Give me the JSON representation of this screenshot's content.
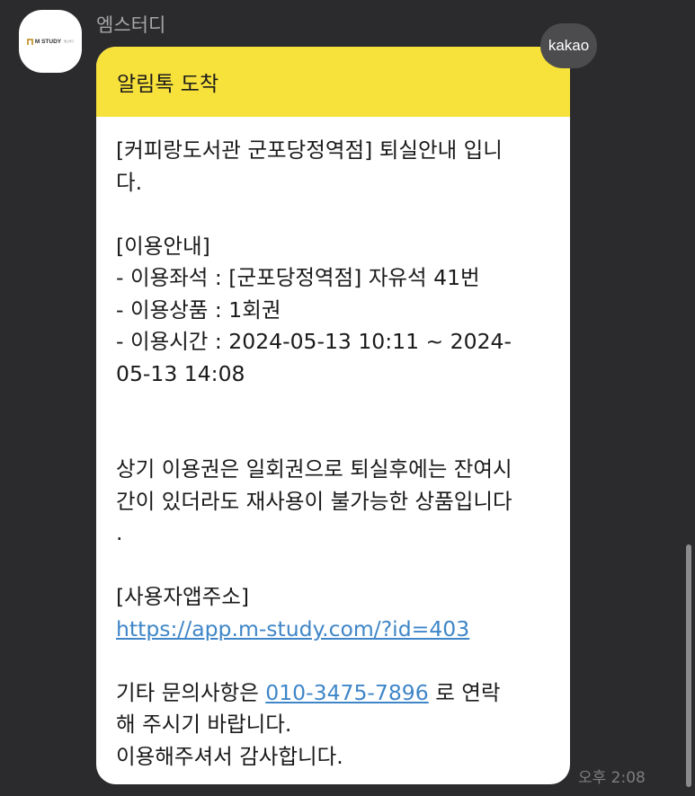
{
  "chat": {
    "sender_name": "엠스터디",
    "avatar_logo_text": "M STUDY",
    "avatar_logo_subtext": "엠스터디",
    "badge_label": "kakao",
    "timestamp": "오후 2:08"
  },
  "message": {
    "header_title": "알림톡 도착",
    "line_1": "[커피랑도서관 군포당정역점] 퇴실안내 입니\n다.\n\n[이용안내]\n- 이용좌석 : [군포당정역점] 자유석 41번\n- 이용상품 : 1회권\n- 이용시간 : 2024-05-13 10:11 ~ 2024-\n05-13 14:08\n\n\n상기 이용권은 일회권으로 퇴실후에는 잔여시\n간이 있더라도 재사용이 불가능한 상품입니다\n.\n\n[사용자앱주소]\n",
    "app_link": "https://app.m-study.com/?id=403",
    "line_2_prefix": "\n\n기타 문의사항은 ",
    "phone_link": "010-3475-7896",
    "line_2_suffix": " 로 연락\n해 주시기 바랍니다.\n이용해주셔서 감사합니다."
  },
  "colors": {
    "background": "#2b2b2d",
    "header_yellow": "#f7e13b",
    "link_blue": "#3f86c8",
    "bubble_white": "#ffffff"
  },
  "icons": {
    "avatar": "m-study-logo"
  }
}
